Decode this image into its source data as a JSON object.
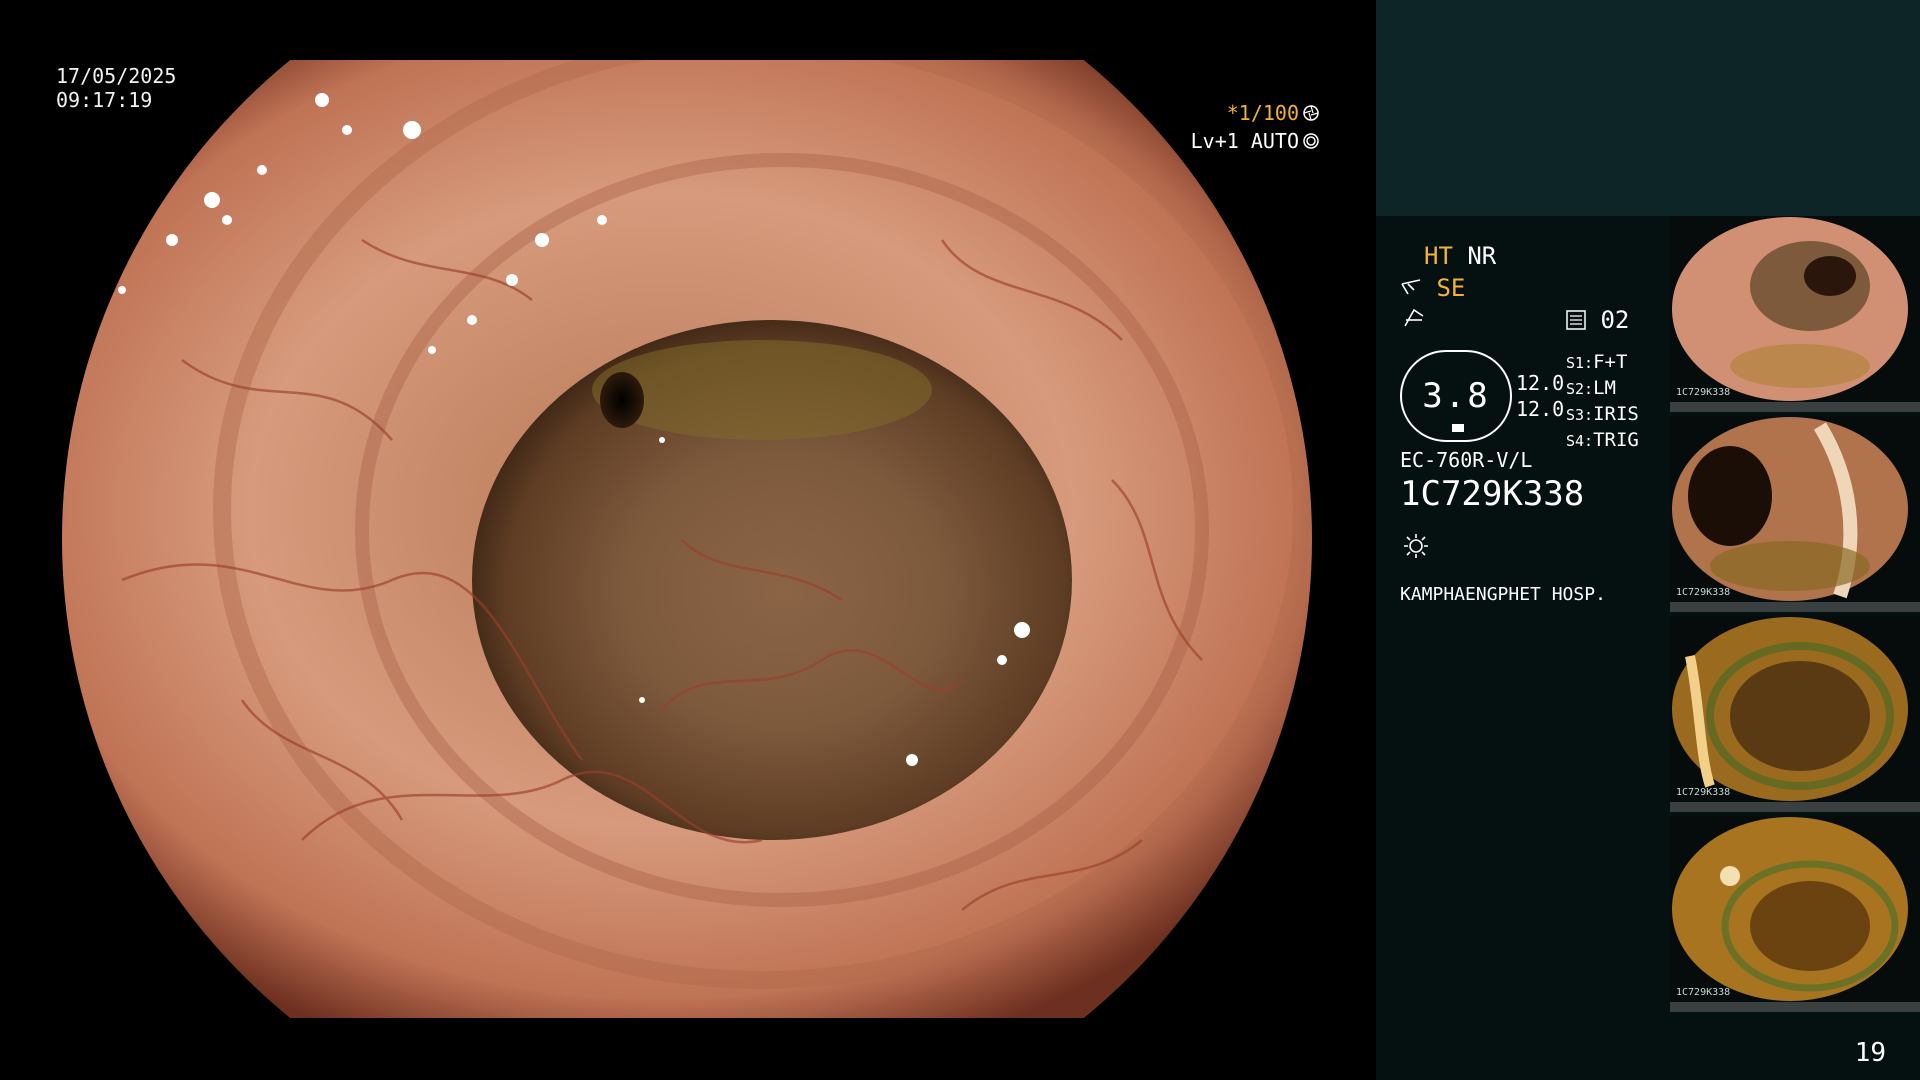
{
  "overlay": {
    "date": "17/05/2025",
    "time": "09:17:19",
    "shutter": "*1/100",
    "level": "Lv+1 AUTO"
  },
  "panel": {
    "mode_ht": "HT",
    "mode_nr": "NR",
    "mode_se": "SE",
    "storage_count": "02",
    "gauge_value": "3.8",
    "setting_a": "12.0",
    "setting_b": "12.0",
    "switches": [
      {
        "key": "S1:",
        "value": "F+T"
      },
      {
        "key": "S2:",
        "value": "LM"
      },
      {
        "key": "S3:",
        "value": "IRIS"
      },
      {
        "key": "S4:",
        "value": "TRIG"
      }
    ],
    "scope_model": "EC-760R-V/L",
    "scope_serial": "1C729K338",
    "hospital": "KAMPHAENGPHET HOSP.",
    "page_number": "19"
  },
  "thumbnails": [
    {
      "caption": "1C729K338"
    },
    {
      "caption": "1C729K338"
    },
    {
      "caption": "1C729K338"
    },
    {
      "caption": "1C729K338"
    }
  ],
  "colors": {
    "accent_yellow": "#f3b23a",
    "panel_dark": "#041110",
    "panel_top": "#0d2526",
    "mucosa": "#c8886c",
    "lumen": "#6b4a2c"
  },
  "icons": [
    "aperture-icon",
    "target-icon",
    "scissors-icon",
    "freeze-icon",
    "memory-icon",
    "light-icon"
  ]
}
